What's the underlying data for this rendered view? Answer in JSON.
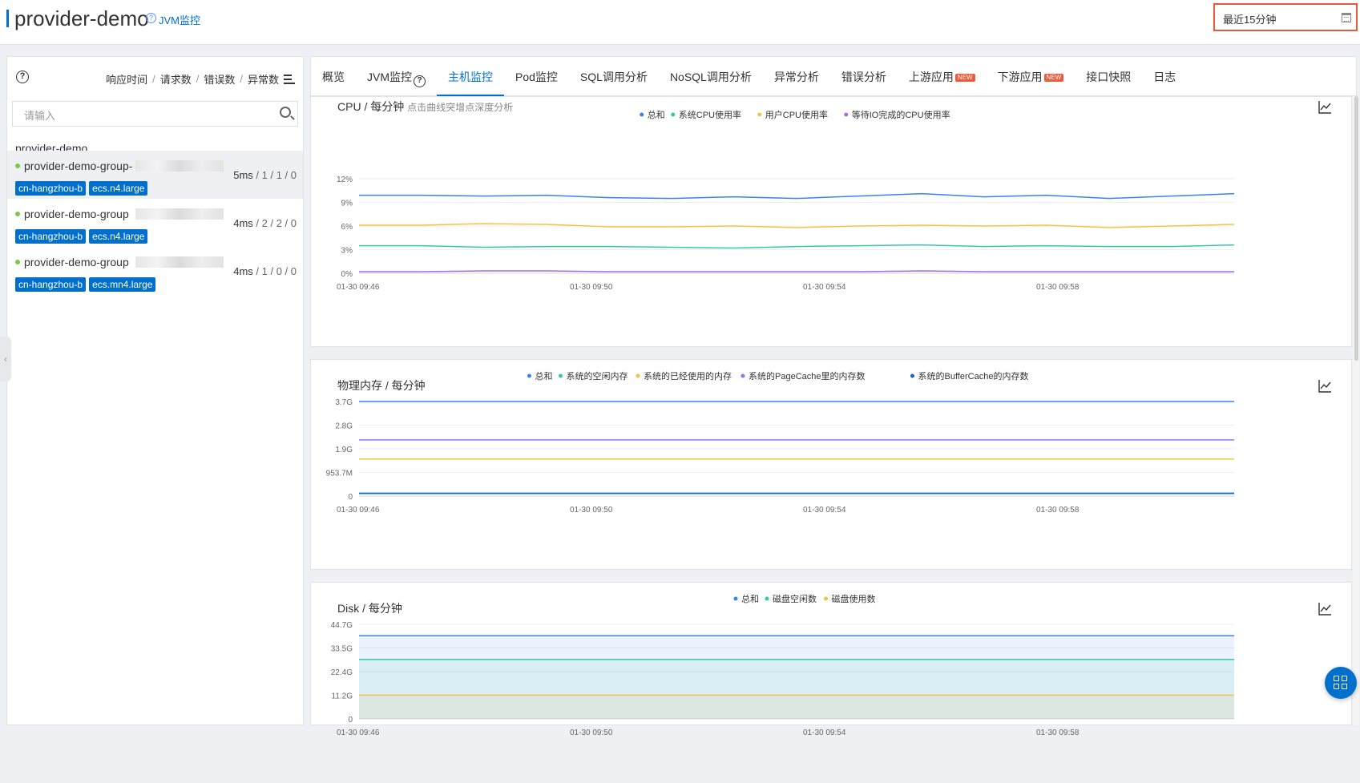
{
  "header": {
    "app_title": "provider-demo",
    "help_glyph": "?",
    "jvm_link": "JVM监控",
    "time_range": "最近15分钟",
    "calendar_icon": "calendar-icon"
  },
  "sidebar": {
    "help_glyph": "?",
    "sort_options": [
      "响应时间",
      "请求数",
      "错误数",
      "异常数"
    ],
    "search_placeholder": "请输入",
    "group_title": "provider-demo",
    "instances": [
      {
        "name": "provider-demo-group-",
        "stats_main": "5ms",
        "stats_rest": " / 1 / 1 / 0",
        "tags": [
          "cn-hangzhou-b",
          "ecs.n4.large"
        ],
        "status": "green",
        "selected": true
      },
      {
        "name": "provider-demo-group",
        "stats_main": "4ms",
        "stats_rest": " / 2 / 2 / 0",
        "tags": [
          "cn-hangzhou-b",
          "ecs.n4.large"
        ],
        "status": "green",
        "selected": false
      },
      {
        "name": "provider-demo-group",
        "stats_main": "4ms",
        "stats_rest": " / 1 / 0 / 0",
        "tags": [
          "cn-hangzhou-b",
          "ecs.mn4.large"
        ],
        "status": "green",
        "selected": false
      }
    ]
  },
  "tabs": [
    {
      "label": "概览"
    },
    {
      "label": "JVM监控",
      "help": "?"
    },
    {
      "label": "主机监控",
      "active": true
    },
    {
      "label": "Pod监控"
    },
    {
      "label": "SQL调用分析"
    },
    {
      "label": "NoSQL调用分析"
    },
    {
      "label": "异常分析"
    },
    {
      "label": "错误分析"
    },
    {
      "label": "上游应用",
      "badge": "NEW"
    },
    {
      "label": "下游应用",
      "badge": "NEW"
    },
    {
      "label": "接口快照"
    },
    {
      "label": "日志"
    }
  ],
  "chart_data": [
    {
      "type": "line",
      "title": "CPU / 每分钟",
      "hint": "点击曲线突增点深度分析",
      "x": [
        "01-30 09:46",
        "01-30 09:47",
        "01-30 09:48",
        "01-30 09:49",
        "01-30 09:50",
        "01-30 09:51",
        "01-30 09:52",
        "01-30 09:53",
        "01-30 09:54",
        "01-30 09:55",
        "01-30 09:56",
        "01-30 09:57",
        "01-30 09:58",
        "01-30 09:59",
        "01-30 10:00"
      ],
      "x_tick_labels": [
        "01-30 09:46",
        "01-30 09:50",
        "01-30 09:54",
        "01-30 09:58"
      ],
      "y_tick_labels": [
        "0%",
        "3%",
        "6%",
        "9%",
        "12%"
      ],
      "ylim": [
        0,
        12
      ],
      "legend_position": "top-center",
      "series": [
        {
          "name": "总和",
          "color": "#3b82f0",
          "values": [
            9.9,
            9.9,
            9.8,
            9.9,
            9.6,
            9.5,
            9.7,
            9.5,
            9.8,
            10.1,
            9.7,
            9.9,
            9.5,
            9.8,
            10.1
          ]
        },
        {
          "name": "系统CPU使用率",
          "color": "#36c9a8",
          "values": [
            3.5,
            3.5,
            3.3,
            3.4,
            3.4,
            3.3,
            3.2,
            3.4,
            3.5,
            3.6,
            3.4,
            3.5,
            3.4,
            3.4,
            3.6
          ]
        },
        {
          "name": "用户CPU使用率",
          "color": "#f5c344",
          "values": [
            6.1,
            6.1,
            6.3,
            6.2,
            5.9,
            5.9,
            6.0,
            5.8,
            6.0,
            6.1,
            6.0,
            6.1,
            5.8,
            6.0,
            6.2
          ]
        },
        {
          "name": "等待IO完成的CPU使用率",
          "color": "#9b6ff0",
          "values": [
            0.2,
            0.2,
            0.3,
            0.3,
            0.2,
            0.2,
            0.2,
            0.2,
            0.2,
            0.3,
            0.2,
            0.2,
            0.2,
            0.2,
            0.2
          ]
        }
      ]
    },
    {
      "type": "line",
      "title": "物理内存 / 每分钟",
      "x_tick_labels": [
        "01-30 09:46",
        "01-30 09:50",
        "01-30 09:54",
        "01-30 09:58"
      ],
      "y_tick_labels": [
        "0",
        "953.7M",
        "1.9G",
        "2.8G",
        "3.7G"
      ],
      "ylim": [
        0,
        3.7
      ],
      "legend_position": "top-center",
      "series": [
        {
          "name": "总和",
          "color": "#3b82f0",
          "values": [
            3.7,
            3.7
          ]
        },
        {
          "name": "系统的空闲内存",
          "color": "#36c9a8",
          "values": [
            0.12,
            0.12
          ]
        },
        {
          "name": "系统的已经使用的内存",
          "color": "#f5c344",
          "values": [
            1.45,
            1.45
          ]
        },
        {
          "name": "系统的PageCache里的内存数",
          "color": "#9b6ff0",
          "values": [
            2.2,
            2.2
          ]
        },
        {
          "name": "系统的BufferCache的内存数",
          "color": "#1a5fd6",
          "values": [
            0.1,
            0.1
          ]
        }
      ]
    },
    {
      "type": "area",
      "title": "Disk / 每分钟",
      "x_tick_labels": [
        "01-30 09:46",
        "01-30 09:50",
        "01-30 09:54",
        "01-30 09:58"
      ],
      "y_tick_labels": [
        "0",
        "11.2G",
        "22.4G",
        "33.5G",
        "44.7G"
      ],
      "ylim": [
        0,
        44.7
      ],
      "legend_position": "top-center",
      "series": [
        {
          "name": "总和",
          "color": "#3b82f0",
          "values": [
            39.3,
            39.3
          ]
        },
        {
          "name": "磁盘空闲数",
          "color": "#36c9a8",
          "values": [
            28.1,
            28.1
          ]
        },
        {
          "name": "磁盘使用数",
          "color": "#f5c344",
          "values": [
            11.2,
            11.2
          ]
        }
      ]
    }
  ]
}
